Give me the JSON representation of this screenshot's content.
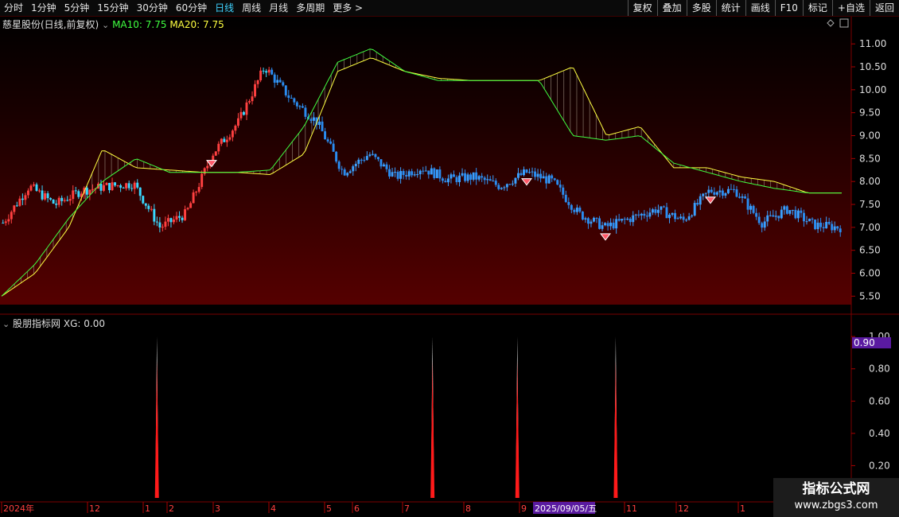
{
  "toolbar": {
    "periods": [
      "分时",
      "1分钟",
      "5分钟",
      "15分钟",
      "30分钟",
      "60分钟",
      "日线",
      "周线",
      "月线",
      "多周期",
      "更多 >"
    ],
    "active_period": "日线",
    "buttons": [
      "复权",
      "叠加",
      "多股",
      "统计",
      "画线",
      "F10",
      "标记",
      "+自选",
      "返回"
    ]
  },
  "main_chart": {
    "stock_label": "慈星股份(日线,前复权)",
    "ma10_label": "MA10: 7.75",
    "ma20_label": "MA20: 7.75",
    "y_ticks": [
      "11.00",
      "10.50",
      "10.00",
      "9.50",
      "9.00",
      "8.50",
      "8.00",
      "7.50",
      "7.00",
      "6.50",
      "6.00",
      "5.50"
    ],
    "colors": {
      "ma10": "#40ff40",
      "ma20": "#ffff40",
      "candle_up": "#ff4040",
      "candle_down": "#2aa0ff",
      "bg_bottom": "#4a0000"
    }
  },
  "sub_chart": {
    "indicator_label": "股朋指标网",
    "xg_label": "XG: 0.00",
    "y_ticks": [
      "1.00",
      "0.80",
      "0.60",
      "0.40",
      "0.20"
    ],
    "highlight_value": "0.90"
  },
  "x_axis": {
    "labels": [
      "2024年",
      "12",
      "1",
      "2",
      "3",
      "4",
      "5",
      "6",
      "7",
      "8",
      "9",
      "11",
      "12",
      "1"
    ],
    "highlight_date": "2025/09/05/五"
  },
  "watermark": {
    "title": "指标公式网",
    "url": "www.zbgs3.com"
  },
  "chart_data": [
    {
      "type": "line",
      "title": "",
      "y_range": [
        5.35,
        11.35
      ],
      "series": [
        {
          "name": "MA10",
          "values": [
            5.5,
            6.2,
            7.2,
            8.0,
            8.5,
            8.2,
            8.2,
            8.2,
            8.25,
            9.2,
            10.6,
            10.9,
            10.4,
            10.2,
            10.2,
            10.2,
            10.2,
            9.0,
            8.9,
            9.0,
            8.4,
            8.2,
            8.0,
            7.85,
            7.75,
            7.75
          ]
        },
        {
          "name": "MA20",
          "values": [
            5.5,
            6.0,
            7.0,
            8.7,
            8.3,
            8.25,
            8.2,
            8.2,
            8.15,
            8.6,
            10.4,
            10.7,
            10.4,
            10.25,
            10.2,
            10.2,
            10.2,
            10.5,
            9.0,
            9.2,
            8.3,
            8.3,
            8.1,
            8.0,
            7.75,
            7.75
          ]
        }
      ],
      "close": [
        7.1,
        7.9,
        7.5,
        7.8,
        7.9,
        7.95,
        7.0,
        7.3,
        8.6,
        9.3,
        10.5,
        9.8,
        9.3,
        8.2,
        8.6,
        8.1,
        8.3,
        8.05,
        8.1,
        7.9,
        8.2,
        8.0,
        7.3,
        7.0,
        7.2,
        7.4,
        7.15,
        7.8,
        7.8,
        7.1,
        7.4,
        7.05,
        7.0
      ],
      "markers_at_index": [
        8,
        20,
        23,
        27
      ]
    },
    {
      "type": "bar",
      "title": "",
      "y_range": [
        0,
        1.05
      ],
      "signals": [
        {
          "position": 0.185,
          "value": 1.0
        },
        {
          "position": 0.51,
          "value": 1.0
        },
        {
          "position": 0.61,
          "value": 1.0
        },
        {
          "position": 0.726,
          "value": 1.0
        }
      ]
    }
  ]
}
